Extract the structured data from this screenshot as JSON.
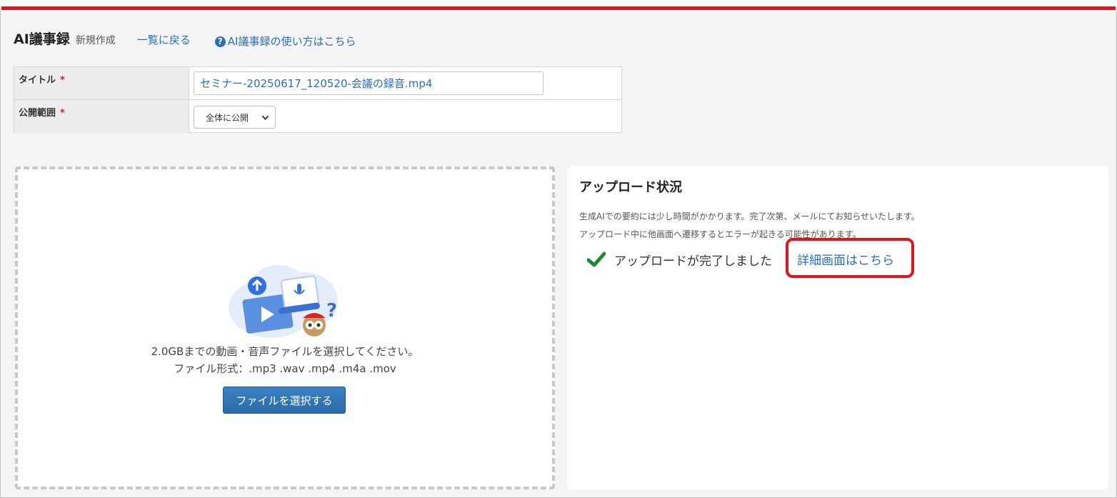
{
  "header": {
    "title": "AI議事録",
    "subtitle": "新規作成",
    "back_link": "一覧に戻る",
    "help_link": "AI議事録の使い方はこちら",
    "help_icon": "question-circle-icon"
  },
  "form": {
    "title_label": "タイトル",
    "title_required": "*",
    "title_value": "セミナー-20250617_120520-会議の録音.mp4",
    "scope_label": "公開範囲",
    "scope_required": "*",
    "scope_value": "全体に公開"
  },
  "dropzone": {
    "instruction": "2.0GBまでの動画・音声ファイルを選択してください。",
    "formats": "ファイル形式：.mp3 .wav .mp4 .m4a .mov",
    "button_label": "ファイルを選択する"
  },
  "status": {
    "title": "アップロード状況",
    "note1": "生成AIでの要約には少し時間がかかります。完了次第、メールにてお知らせいたします。",
    "note2": "アップロード中に他画面へ遷移するとエラーが起きる可能性があります。",
    "complete_text": "アップロードが完了しました",
    "detail_link": "詳細画面はこちら"
  },
  "colors": {
    "accent_red": "#e0141c",
    "link_blue": "#2a6ebb",
    "button_blue": "#2f74b5",
    "check_green": "#1e8a2e"
  }
}
